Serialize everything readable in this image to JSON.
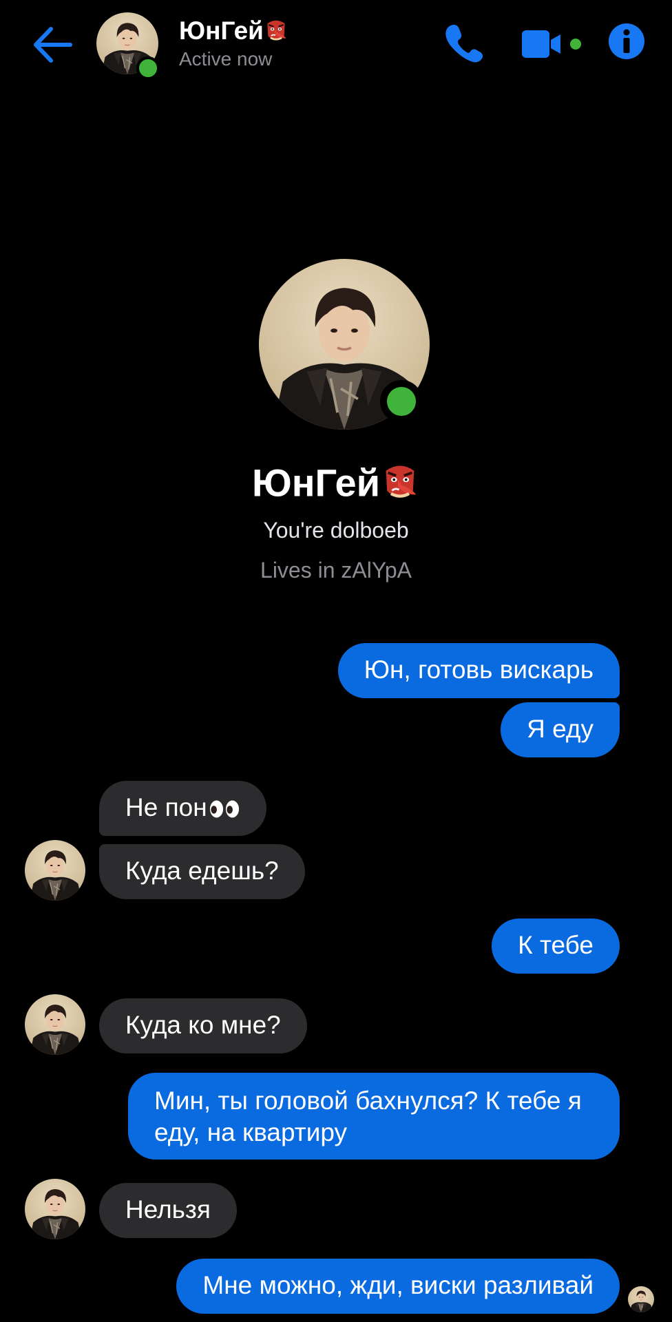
{
  "header": {
    "contact_name": "ЮнГей",
    "status": "Active now"
  },
  "profile": {
    "name": "ЮнГей",
    "tagline": "You're dolboeb",
    "location": "Lives in zAlYpA"
  },
  "messages": [
    {
      "dir": "out",
      "text": "Юн, готовь вискарь"
    },
    {
      "dir": "out",
      "text": "Я еду"
    },
    {
      "dir": "in",
      "text": "Не пон"
    },
    {
      "dir": "in",
      "text": "Куда едешь?"
    },
    {
      "dir": "out",
      "text": "К тебе"
    },
    {
      "dir": "in",
      "text": "Куда ко мне?"
    },
    {
      "dir": "out",
      "text": "Мин, ты головой бахнулся? К тебе я еду, на квартиру"
    },
    {
      "dir": "in",
      "text": "Нельзя"
    },
    {
      "dir": "out",
      "text": "Мне можно, жди, виски разливай"
    }
  ],
  "icons": {
    "back": "arrow-left-icon",
    "call": "phone-icon",
    "video": "video-camera-icon",
    "info": "info-icon",
    "name_emoji": "tengu-mask-emoji",
    "eyes_emoji": "eyes-emoji"
  },
  "colors": {
    "accent": "#0a6ae0",
    "icon_blue": "#1877f2",
    "incoming_bubble": "#2c2c2e",
    "online": "#3fb33a",
    "background": "#000000"
  }
}
